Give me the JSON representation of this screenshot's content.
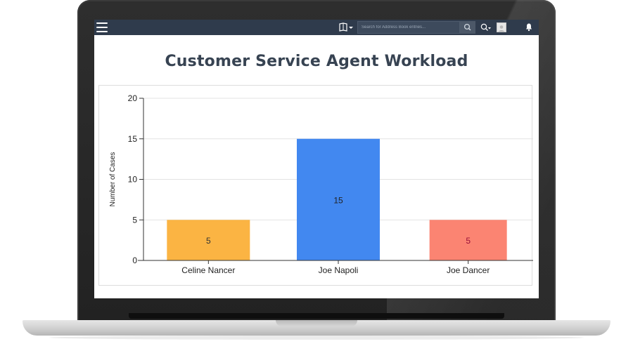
{
  "toolbar": {
    "menu_icon": "hamburger-icon",
    "book_icon": "address-book-icon",
    "search_placeholder": "Search for Address Book entries...",
    "search_icon": "search-icon",
    "history_icon": "recent-history-icon",
    "avatar_icon": "user-avatar",
    "bell_icon": "bell-icon"
  },
  "chart_data": {
    "type": "bar",
    "title": "Customer Service Agent Workload",
    "ylabel": "Number of Cases",
    "xlabel": "",
    "ylim": [
      0,
      20
    ],
    "yticks": [
      0,
      5,
      10,
      15,
      20
    ],
    "grid": true,
    "categories": [
      "Celine Nancer",
      "Joe Napoli",
      "Joe Dancer"
    ],
    "values": [
      5,
      15,
      5
    ],
    "data_labels": [
      "5",
      "15",
      "5"
    ],
    "colors": [
      "#fbb443",
      "#4288f0",
      "#fb8472"
    ],
    "label_colors": [
      "#333333",
      "#222222",
      "#9a0f3a"
    ]
  }
}
